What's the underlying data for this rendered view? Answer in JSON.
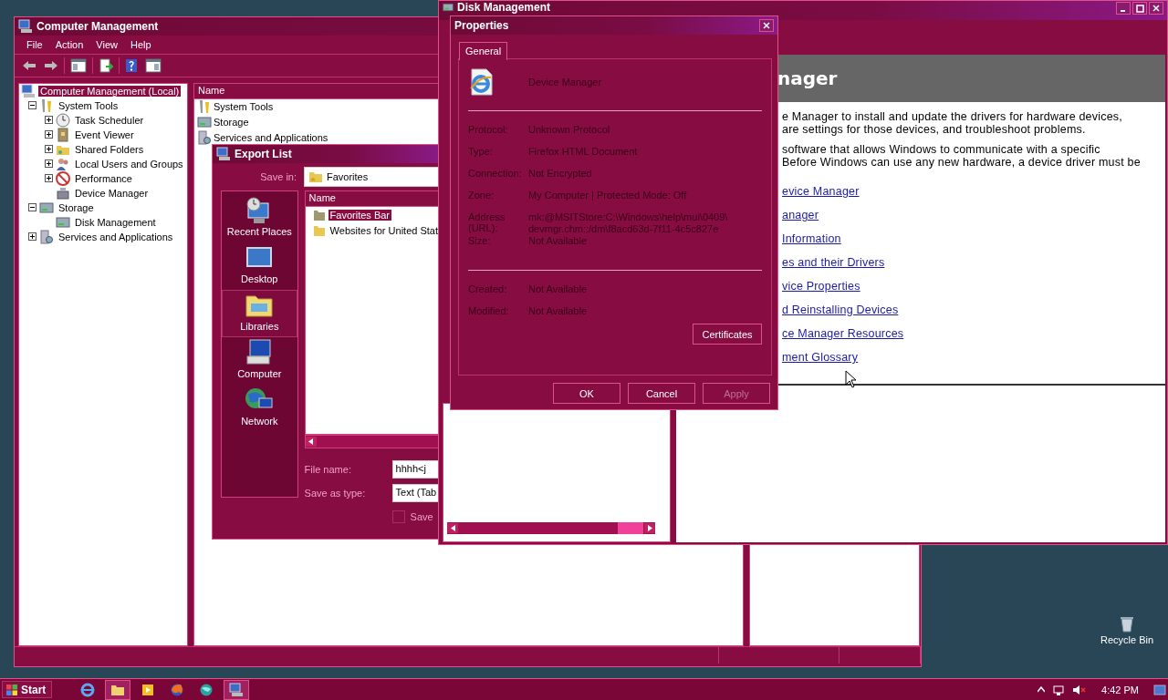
{
  "computer_management": {
    "title": "Computer Management",
    "menu": [
      "File",
      "Action",
      "View",
      "Help"
    ],
    "tree": [
      {
        "label": "Computer Management (Local)",
        "selected": true,
        "children": [
          {
            "label": "System Tools",
            "selected": false,
            "expanded": true,
            "children": [
              {
                "label": "Task Scheduler",
                "selected": false,
                "expanded": false
              },
              {
                "label": "Event Viewer",
                "selected": false,
                "expanded": false
              },
              {
                "label": "Shared Folders",
                "selected": false,
                "expanded": false
              },
              {
                "label": "Local Users and Groups",
                "selected": false,
                "expanded": false
              },
              {
                "label": "Performance",
                "selected": false,
                "expanded": false
              },
              {
                "label": "Device Manager",
                "selected": false
              }
            ]
          },
          {
            "label": "Storage",
            "selected": false,
            "expanded": true,
            "children": [
              {
                "label": "Disk Management",
                "selected": false
              }
            ]
          },
          {
            "label": "Services and Applications",
            "selected": false,
            "expanded": false
          }
        ]
      }
    ],
    "list": {
      "column": "Name",
      "rows": [
        "System Tools",
        "Storage",
        "Services and Applications"
      ]
    }
  },
  "export_list": {
    "title": "Export List",
    "save_in_label": "Save in:",
    "save_in_value": "Favorites",
    "places": [
      {
        "label": "Recent Places",
        "selected": false
      },
      {
        "label": "Desktop",
        "selected": false
      },
      {
        "label": "Libraries",
        "selected": true
      },
      {
        "label": "Computer",
        "selected": false
      },
      {
        "label": "Network",
        "selected": false
      }
    ],
    "column": "Name",
    "files": [
      {
        "name": "Favorites Bar",
        "selected": true
      },
      {
        "name": "Websites for United Stat",
        "selected": false
      }
    ],
    "file_name_label": "File name:",
    "file_name_value": "hhhh<j",
    "save_type_label": "Save as type:",
    "save_type_value": "Text (Tab",
    "save_checkbox": {
      "label": "Save",
      "checked": false
    }
  },
  "disk_management": {
    "title": "Disk Management",
    "help": {
      "heading": "nager",
      "paragraphs": [
        [
          "e Manager to install and update the drivers for hardware devices,",
          "are settings for those devices, and troubleshoot problems."
        ],
        [
          "software that allows Windows to communicate with a specific",
          "Before Windows can use any new hardware, a device driver must be"
        ]
      ],
      "links": [
        "evice Manager",
        "anager",
        "Information",
        "es and their Drivers",
        "vice Properties",
        "d Reinstalling Devices",
        "ce Manager Resources",
        "ment Glossary"
      ]
    }
  },
  "properties": {
    "title": "Properties",
    "tabs": [
      {
        "label": "General",
        "selected": true
      }
    ],
    "name": "Device Manager",
    "groups": [
      [
        {
          "label": "Protocol:",
          "value": "Unknown Protocol"
        },
        {
          "label": "Type:",
          "value": "Firefox HTML Document"
        },
        {
          "label": "Connection:",
          "value": "Not Encrypted"
        },
        {
          "label": "Zone:",
          "value": "My Computer | Protected Mode: Off"
        },
        {
          "label": "Address (URL):",
          "value": "mk:@MSITStore:C:\\Windows\\help\\mui\\0409\\ devmgr.chm::/dm\\f8acd63d-7f11-4c5c827e"
        },
        {
          "label": "Size:",
          "value": "Not Available"
        }
      ],
      [
        {
          "label": "Created:",
          "value": "Not Available"
        },
        {
          "label": "Modified:",
          "value": "Not Available"
        }
      ]
    ],
    "certificates": "Certificates",
    "buttons": [
      {
        "label": "OK",
        "disabled": false
      },
      {
        "label": "Cancel",
        "disabled": false
      },
      {
        "label": "Apply",
        "disabled": true
      }
    ]
  },
  "desktop": {
    "recycle_bin": "Recycle Bin"
  },
  "taskbar": {
    "start": "Start",
    "clock": "4:42 PM"
  }
}
